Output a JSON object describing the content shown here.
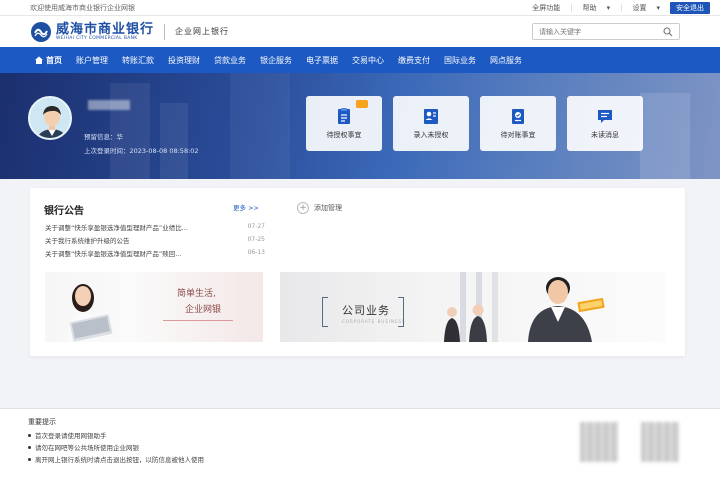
{
  "topbar": {
    "welcome": "欢迎使用威海市商业银行企业网银",
    "links": [
      "全屏功能",
      "帮助",
      "设置"
    ],
    "exit_label": "安全退出"
  },
  "header": {
    "logo_cn": "威海市商业银行",
    "logo_en": "WEIHAI CITY COMMERCIAL BANK",
    "subtitle": "企业网上银行",
    "search_placeholder": "请输入关键字"
  },
  "nav": {
    "items": [
      "首页",
      "账户管理",
      "转账汇款",
      "投资理财",
      "贷款业务",
      "银企服务",
      "电子票据",
      "交易中心",
      "缴费支付",
      "国际业务",
      "网点服务"
    ]
  },
  "user": {
    "last_login_label": "上次登录时间：",
    "last_login_value": "2023-08-08 08:58:02",
    "role_label": "预留信息：",
    "role_value": "华"
  },
  "tiles": [
    {
      "label": "待授权事宜",
      "icon": "document-icon",
      "badge": ""
    },
    {
      "label": "录入未授权",
      "icon": "user-form-icon",
      "badge": ""
    },
    {
      "label": "待对账事宜",
      "icon": "checklist-icon",
      "badge": ""
    },
    {
      "label": "未读消息",
      "icon": "message-icon",
      "badge": ""
    }
  ],
  "announcements": {
    "title": "银行公告",
    "more_label": "更多 >>",
    "rows": [
      {
        "text": "关于调整“快乐享盈银选净值型理财产品”业绩比...",
        "date": "07-27"
      },
      {
        "text": "关于我行系统维护升级的公告",
        "date": "07-25"
      },
      {
        "text": "关于调整“快乐享盈银选净值型理财产品”赎回...",
        "date": "06-13"
      }
    ]
  },
  "add_label": "添加管理",
  "banners": {
    "personal_line1": "简单生活,",
    "personal_line2": "企业网银",
    "business_cn": "公司业务",
    "business_en": "CORPORATE BUSINESS"
  },
  "tips": {
    "title": "重要提示",
    "items": [
      "首次登录请使用网银助手",
      "请勿在网吧等公共场所使用企业网银",
      "离开网上银行系统时请点击退出按钮，以防信息被他人使用"
    ]
  },
  "colors": {
    "brand_blue": "#1d59c2",
    "exit_blue": "#1d56b8",
    "badge_orange": "#f7a21b"
  }
}
